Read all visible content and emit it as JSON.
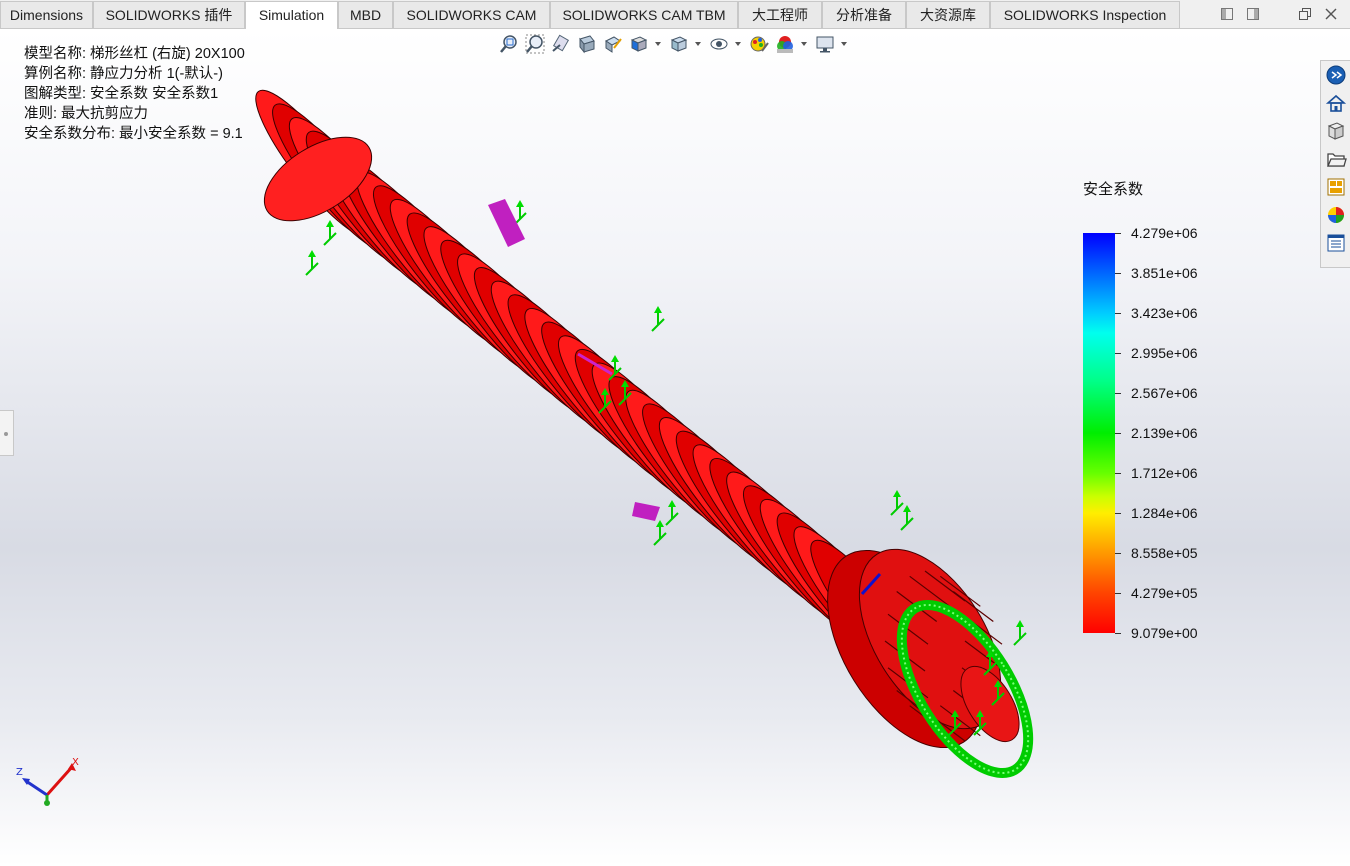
{
  "tabs": [
    {
      "label": "Dimensions",
      "active": false
    },
    {
      "label": "SOLIDWORKS 插件",
      "active": false
    },
    {
      "label": "Simulation",
      "active": true
    },
    {
      "label": "MBD",
      "active": false
    },
    {
      "label": "SOLIDWORKS CAM",
      "active": false
    },
    {
      "label": "SOLIDWORKS CAM TBM",
      "active": false
    },
    {
      "label": "大工程师",
      "active": false
    },
    {
      "label": "分析准备",
      "active": false
    },
    {
      "label": "大资源库",
      "active": false
    },
    {
      "label": "SOLIDWORKS Inspection",
      "active": false
    }
  ],
  "info": {
    "model_name": "模型名称: 梯形丝杠 (右旋) 20X100",
    "study_name": "算例名称: 静应力分析 1(-默认-)",
    "plot_type": "图解类型: 安全系数 安全系数1",
    "criterion": "准则: 最大抗剪应力",
    "fos_distribution": "安全系数分布: 最小安全系数 = 9.1"
  },
  "legend": {
    "title": "安全系数",
    "labels": [
      "4.279e+06",
      "3.851e+06",
      "3.423e+06",
      "2.995e+06",
      "2.567e+06",
      "2.139e+06",
      "1.712e+06",
      "1.284e+06",
      "8.558e+05",
      "4.279e+05",
      "9.079e+00"
    ],
    "max_value": 4279000,
    "min_value": 9.079,
    "colors": [
      "#0000ff",
      "#00ccff",
      "#00ee00",
      "#ffee00",
      "#ff0000"
    ]
  },
  "icons": {
    "hud": [
      "zoom-to-fit-icon",
      "zoom-to-area-icon",
      "previous-view-icon",
      "section-view-icon",
      "dynamic-annotation-icon",
      "view-orientation-icon",
      "display-style-icon",
      "hide-show-items-icon",
      "edit-appearance-icon",
      "apply-scene-icon",
      "view-settings-icon"
    ],
    "taskpane": [
      "solidworks-resources-icon",
      "home-icon",
      "design-library-icon",
      "file-explorer-icon",
      "view-palette-icon",
      "appearances-scenes-icon",
      "custom-properties-icon"
    ],
    "window": [
      "tile-left-icon",
      "tile-right-icon",
      "restore-icon",
      "close-icon"
    ]
  },
  "model_color": "#ff1a1a",
  "fixture_color": "#00dd00",
  "load_color": "#cc22cc"
}
